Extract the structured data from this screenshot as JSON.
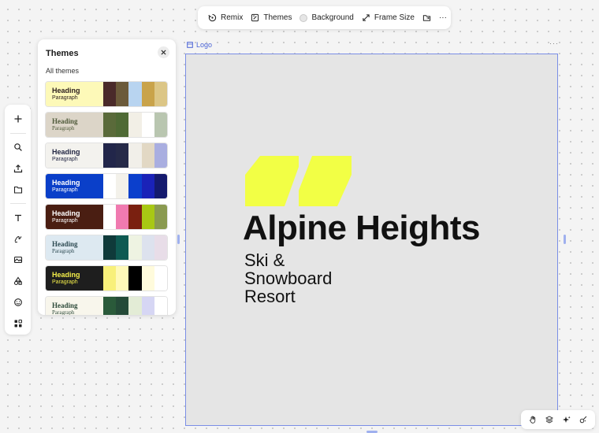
{
  "toolbar": {
    "remix_label": "Remix",
    "themes_label": "Themes",
    "background_label": "Background",
    "frame_size_label": "Frame Size",
    "more_label": "···"
  },
  "themes_panel": {
    "title": "Themes",
    "subtitle": "All themes",
    "close_icon": "close-icon",
    "themes": [
      {
        "heading": "Heading",
        "paragraph": "Paragraph",
        "text_bg": "#fdf9b8",
        "text_color": "#2b1d1d",
        "serif": false,
        "swatches": [
          "#4a2a2a",
          "#6b5a3a",
          "#b8d4f0",
          "#c9a34a",
          "#dcc686"
        ]
      },
      {
        "heading": "Heading",
        "paragraph": "Paragraph",
        "text_bg": "#dcd5c8",
        "text_color": "#4f5a3a",
        "serif": true,
        "swatches": [
          "#5a6a3a",
          "#4f6a35",
          "#f2efe6",
          "#ffffff",
          "#b9c6b0"
        ]
      },
      {
        "heading": "Heading",
        "paragraph": "Paragraph",
        "text_bg": "#f3f2ee",
        "text_color": "#1f2340",
        "serif": false,
        "swatches": [
          "#22264a",
          "#262a48",
          "#f1efe9",
          "#e2d8c4",
          "#a9aee0"
        ]
      },
      {
        "heading": "Heading",
        "paragraph": "Paragraph",
        "text_bg": "#0a3fc9",
        "text_color": "#ffffff",
        "serif": false,
        "swatches": [
          "#ffffff",
          "#f3f1ea",
          "#0b3fcc",
          "#1a22b8",
          "#141a6e"
        ]
      },
      {
        "heading": "Heading",
        "paragraph": "Paragraph",
        "text_bg": "#4a1e12",
        "text_color": "#ffffff",
        "serif": false,
        "swatches": [
          "#ffffff",
          "#f07ab0",
          "#7a2010",
          "#a8c814",
          "#8a9a50"
        ]
      },
      {
        "heading": "Heading",
        "paragraph": "Paragraph",
        "text_bg": "#dde9f1",
        "text_color": "#2d4a52",
        "serif": true,
        "swatches": [
          "#0f3a3a",
          "#0e5a52",
          "#eef3e2",
          "#dde2ee",
          "#e8dde8"
        ]
      },
      {
        "heading": "Heading",
        "paragraph": "Paragraph",
        "text_bg": "#1e1e1e",
        "text_color": "#f5ef4a",
        "serif": false,
        "swatches": [
          "#f8f07a",
          "#fff9b8",
          "#000000",
          "#fffbdc",
          "#ffffff"
        ]
      },
      {
        "heading": "Heading",
        "paragraph": "Paragraph",
        "text_bg": "#f8f6ec",
        "text_color": "#2d4a3a",
        "serif": true,
        "swatches": [
          "#2a5a3a",
          "#244a38",
          "#e3ecd6",
          "#d6d6f4",
          "#ffffff"
        ]
      }
    ]
  },
  "canvas": {
    "frame_label": "Logo",
    "frame_more": "···",
    "logo": {
      "title": "Alpine Heights",
      "subtitle_lines": [
        "Ski &",
        "Snowboard",
        "Resort"
      ],
      "accent_color": "#f2ff45"
    }
  },
  "rail": {
    "items": [
      "add-icon",
      "search-icon",
      "upload-icon",
      "folder-icon",
      "text-icon",
      "draw-icon",
      "image-icon",
      "shapes-icon",
      "emoji-icon",
      "apps-icon"
    ]
  },
  "mini_toolbar": {
    "items": [
      "hand-icon",
      "layers-icon",
      "sparkle-icon",
      "magic-icon"
    ]
  }
}
